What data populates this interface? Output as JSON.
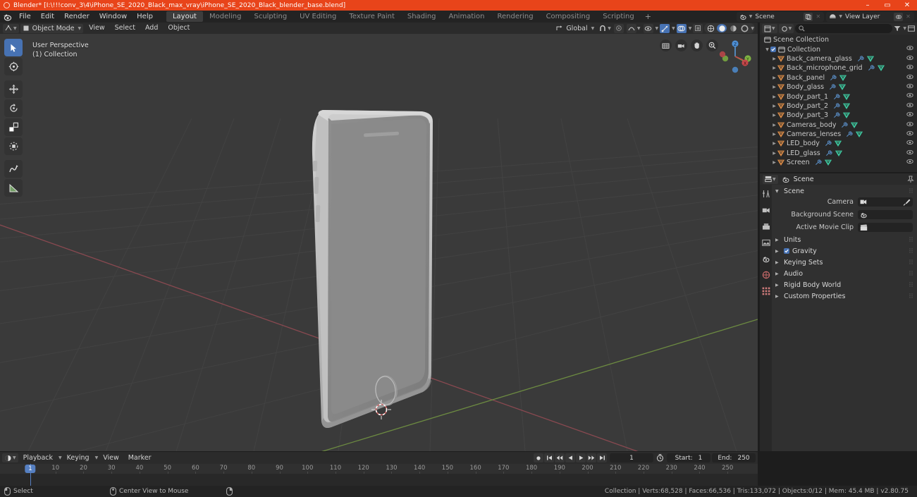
{
  "window": {
    "title": "Blender* [I:\\!!!conv_3\\4\\iPhone_SE_2020_Black_max_vray\\iPhone_SE_2020_Black_blender_base.blend]",
    "minimize": "–",
    "maximize": "▭",
    "close": "✕",
    "accent": "#e8441a"
  },
  "menubar": {
    "items": [
      "File",
      "Edit",
      "Render",
      "Window",
      "Help"
    ],
    "workspaces": [
      {
        "label": "Layout",
        "active": true
      },
      {
        "label": "Modeling",
        "active": false
      },
      {
        "label": "Sculpting",
        "active": false
      },
      {
        "label": "UV Editing",
        "active": false
      },
      {
        "label": "Texture Paint",
        "active": false
      },
      {
        "label": "Shading",
        "active": false
      },
      {
        "label": "Animation",
        "active": false
      },
      {
        "label": "Rendering",
        "active": false
      },
      {
        "label": "Compositing",
        "active": false
      },
      {
        "label": "Scripting",
        "active": false
      }
    ],
    "add_workspace": "+",
    "scene_name": "Scene",
    "view_layer_name": "View Layer",
    "new_scene_icon": "copy-icon",
    "remove_scene_icon": "x-icon"
  },
  "viewport_header": {
    "editor_type": "editor-type-icon",
    "mode": "Object Mode",
    "menus": [
      "View",
      "Select",
      "Add",
      "Object"
    ],
    "transform_orientation": "Global",
    "snap_icon": "magnet-icon",
    "proportional_icon": "proportional-edit-icon",
    "overlays_icon": "overlays-icon",
    "xray_icon": "xray-icon",
    "shading_modes": [
      "wireframe",
      "solid",
      "material-preview",
      "rendered"
    ],
    "active_shading": "solid",
    "visibility_icon": "visibility-icon",
    "gizmo_icon": "gizmo-icon"
  },
  "viewport": {
    "overlay_line1": "User Perspective",
    "overlay_line2": "(1) Collection",
    "tools": [
      {
        "name": "tweak-select-tool",
        "active": true
      },
      {
        "name": "cursor-tool",
        "active": false
      },
      {
        "name": "move-tool",
        "active": false
      },
      {
        "name": "rotate-tool",
        "active": false
      },
      {
        "name": "scale-tool",
        "active": false
      },
      {
        "name": "transform-tool",
        "active": false
      },
      {
        "name": "annotate-tool",
        "active": false
      },
      {
        "name": "measure-tool",
        "active": false
      }
    ],
    "nav_buttons": [
      "camera-perspective-icon",
      "camera-view-icon",
      "hand-pan-icon",
      "zoom-icon"
    ],
    "gizmo_axes": [
      "X",
      "Y",
      "Z"
    ],
    "background_color": "#3a3a3a",
    "grid_color": "#4b4b4b",
    "axis_x_color": "#9c4b54",
    "axis_y_color": "#6b8f3a",
    "model_color": "#9a9a9a"
  },
  "outliner": {
    "display_mode_icon": "outliner-icon",
    "filter_icon": "filter-icon",
    "search_icon": "search-icon",
    "search_placeholder": "",
    "root": "Scene Collection",
    "collection": "Collection",
    "objects": [
      "Back_camera_glass",
      "Back_microphone_grid",
      "Back_panel",
      "Body_glass",
      "Body_part_1",
      "Body_part_2",
      "Body_part_3",
      "Cameras_body",
      "Cameras_lenses",
      "LED_body",
      "LED_glass",
      "Screen"
    ]
  },
  "properties": {
    "editor_icon": "properties-editor-icon",
    "breadcrumb_icon": "scene-icon",
    "breadcrumb": "Scene",
    "pin_icon": "pin-icon",
    "tabs": [
      "tool-tab",
      "render-tab",
      "output-tab",
      "view-layer-tab",
      "scene-tab",
      "world-tab",
      "object-tab"
    ],
    "active_tab": "scene-tab",
    "section_title": "Scene",
    "fields": [
      {
        "label": "Camera",
        "value": "",
        "icon": "camera-icon",
        "extra": "eyedropper-icon"
      },
      {
        "label": "Background Scene",
        "value": "",
        "icon": "scene-icon",
        "extra": ""
      },
      {
        "label": "Active Movie Clip",
        "value": "",
        "icon": "clip-icon",
        "extra": ""
      }
    ],
    "panels": [
      {
        "label": "Units",
        "checkbox": false
      },
      {
        "label": "Gravity",
        "checkbox": true
      },
      {
        "label": "Keying Sets",
        "checkbox": false
      },
      {
        "label": "Audio",
        "checkbox": false
      },
      {
        "label": "Rigid Body World",
        "checkbox": false
      },
      {
        "label": "Custom Properties",
        "checkbox": false
      }
    ]
  },
  "timeline": {
    "editor_icon": "timeline-icon",
    "menus": [
      "Playback",
      "Keying",
      "View",
      "Marker"
    ],
    "transport": [
      "record-icon",
      "jump-start-icon",
      "prev-keyframe-icon",
      "play-reverse-icon",
      "play-icon",
      "next-keyframe-icon",
      "jump-end-icon"
    ],
    "current_frame": "1",
    "autokey_icon": "autokey-icon",
    "start_label": "Start:",
    "start_value": "1",
    "end_label": "End:",
    "end_value": "250",
    "ruler_ticks": [
      10,
      20,
      30,
      40,
      50,
      60,
      70,
      80,
      90,
      100,
      110,
      120,
      130,
      140,
      150,
      160,
      170,
      180,
      190,
      200,
      210,
      220,
      230,
      240,
      250
    ],
    "playhead_frame": "1",
    "playhead_color": "#5680c2"
  },
  "statusbar": {
    "left_items": [
      {
        "icon": "mouse-left-icon",
        "label": "Select"
      },
      {
        "icon": "mouse-middle-icon",
        "label": "Center View to Mouse"
      },
      {
        "icon": "mouse-right-icon",
        "label": ""
      }
    ],
    "stats": "Collection | Verts:68,528 | Faces:66,536 | Tris:133,072 | Objects:0/12 | Mem: 45.4 MB | v2.80.75"
  }
}
